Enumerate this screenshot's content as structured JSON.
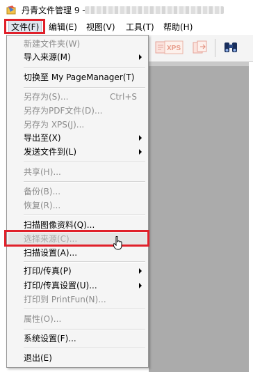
{
  "titlebar": {
    "title": "丹青文件管理 9 -"
  },
  "menubar": {
    "items": [
      {
        "label": "文件(F)"
      },
      {
        "label": "编辑(E)"
      },
      {
        "label": "视图(V)"
      },
      {
        "label": "工具(T)"
      },
      {
        "label": "帮助(H)"
      }
    ]
  },
  "toolbar": {
    "buttons": [
      {
        "icon": "convert-icon"
      },
      {
        "icon": "xps-icon",
        "label": "XPS"
      },
      {
        "icon": "export-icon"
      },
      {
        "icon": "binoculars-icon"
      }
    ]
  },
  "file_menu": {
    "items": [
      {
        "label": "新建文件夹(W)",
        "enabled": false
      },
      {
        "label": "导入来源(M)",
        "enabled": true,
        "submenu": true
      },
      {
        "label": "切换至 My PageManager(T)",
        "enabled": true
      },
      {
        "label": "另存为(S)...",
        "enabled": false,
        "shortcut": "Ctrl+S"
      },
      {
        "label": "另存为PDF文件(D)...",
        "enabled": false
      },
      {
        "label": "另存为 XPS(J)...",
        "enabled": false
      },
      {
        "label": "导出至(X)",
        "enabled": true,
        "submenu": true
      },
      {
        "label": "发送文件到(L)",
        "enabled": true,
        "submenu": true
      },
      {
        "label": "共享(H)...",
        "enabled": false
      },
      {
        "label": "备份(B)...",
        "enabled": false
      },
      {
        "label": "恢复(R)...",
        "enabled": false
      },
      {
        "label": "扫描图像资料(Q)...",
        "enabled": true
      },
      {
        "label": "选择来源(C)...",
        "enabled": false,
        "highlighted": true
      },
      {
        "label": "扫描设置(A)...",
        "enabled": true
      },
      {
        "label": "打印/传真(P)",
        "enabled": true,
        "submenu": true
      },
      {
        "label": "打印/传真设置(U)...",
        "enabled": true,
        "submenu": true
      },
      {
        "label": "打印到 PrintFun(N)...",
        "enabled": false
      },
      {
        "label": "属性(O)...",
        "enabled": false
      },
      {
        "label": "系统设置(F)...",
        "enabled": true
      },
      {
        "label": "退出(E)",
        "enabled": true
      }
    ]
  },
  "colors": {
    "highlight_box": "#e0202a",
    "disabled_text": "#8c8c8c",
    "workspace": "#ababab"
  }
}
